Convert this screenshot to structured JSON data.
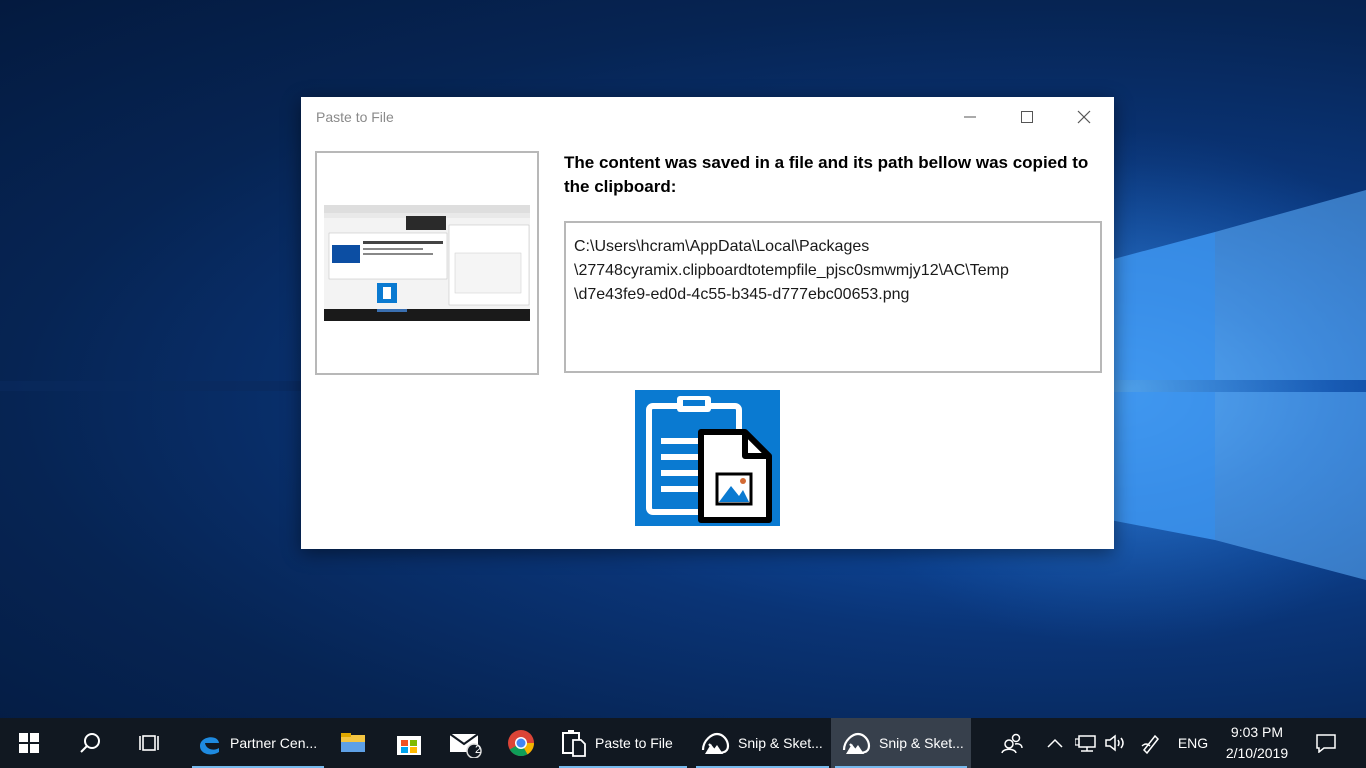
{
  "window": {
    "title": "Paste to File",
    "message": "The content was saved in a file and its path bellow was copied to the clipboard:",
    "file_path": "C:\\Users\\hcram\\AppData\\Local\\Packages\n\\27748cyramix.clipboardtotempfile_pjsc0smwmjy12\\AC\\Temp\n\\d7e43fe9-ed0d-4c55-b345-d777ebc00653.png"
  },
  "taskbar": {
    "apps": [
      {
        "label": "Partner Cen...",
        "icon": "edge-icon"
      },
      {
        "label": "",
        "icon": "file-explorer-icon"
      },
      {
        "label": "",
        "icon": "store-icon"
      },
      {
        "label": "",
        "icon": "mail-icon",
        "badge": "2"
      },
      {
        "label": "",
        "icon": "chrome-icon"
      },
      {
        "label": "Paste to File",
        "icon": "paste-to-file-icon"
      },
      {
        "label": "Snip & Sket...",
        "icon": "snip-sketch-icon"
      },
      {
        "label": "Snip & Sket...",
        "icon": "snip-sketch-icon"
      }
    ],
    "language": "ENG",
    "time": "9:03 PM",
    "date": "2/10/2019"
  },
  "colors": {
    "accent": "#0078d7",
    "taskbar": "#111821",
    "active_underline": "#76b9ed"
  }
}
